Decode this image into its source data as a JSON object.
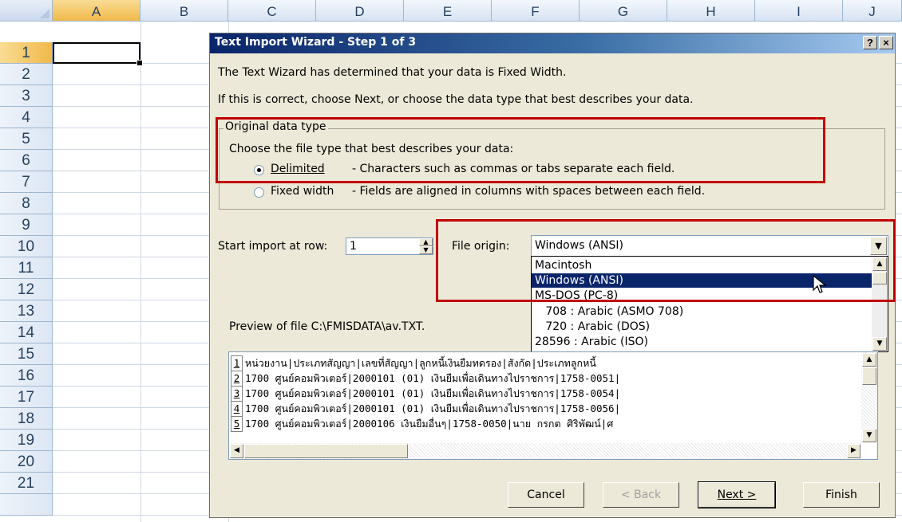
{
  "spreadsheet": {
    "columns": [
      "A",
      "B",
      "C",
      "D",
      "E",
      "F",
      "G",
      "H",
      "I",
      "J"
    ],
    "rows": [
      "1",
      "2",
      "3",
      "4",
      "5",
      "6",
      "7",
      "8",
      "9",
      "10",
      "11",
      "12",
      "13",
      "14",
      "15",
      "16",
      "17",
      "18",
      "19",
      "20",
      "21"
    ],
    "selected_column": "A",
    "selected_row": "1"
  },
  "dialog": {
    "title": "Text Import Wizard - Step 1 of 3",
    "help_button": "?",
    "close_button": "×",
    "intro_line1": "The Text Wizard has determined that your data is Fixed Width.",
    "intro_line2": "If this is correct, choose Next, or choose the data type that best describes your data.",
    "group_label": "Original data type",
    "choose_text": "Choose the file type that best describes your data:",
    "delimited_label": "Delimited",
    "delimited_desc": "- Characters such as commas or tabs separate each field.",
    "fixed_label": "Fixed width",
    "fixed_desc": "- Fields are aligned in columns with spaces between each field.",
    "start_row_label": "Start import at row:",
    "start_row_value": "1",
    "file_origin_label": "File origin:",
    "file_origin_value": "Windows (ANSI)",
    "file_origin_options": [
      "Macintosh",
      "Windows (ANSI)",
      "MS-DOS (PC-8)",
      "   708 : Arabic (ASMO 708)",
      "   720 : Arabic (DOS)",
      "28596 : Arabic (ISO)"
    ],
    "preview_label": "Preview of file C:\\FMISDATA\\av.TXT.",
    "preview_lines": [
      {
        "num": "1",
        "text": "หน่วยงาน|ประเภทสัญญา|เลขที่สัญญา|ลูกหนี้เงินยืมทดรอง|สังกัด|ประเภทลูกหนี้"
      },
      {
        "num": "2",
        "text": "1700 ศูนย์คอมพิวเตอร์|2000101  (01)  เงินยืมเพื่อเดินทางไปราชการ|1758-0051|"
      },
      {
        "num": "3",
        "text": "1700 ศูนย์คอมพิวเตอร์|2000101  (01)  เงินยืมเพื่อเดินทางไปราชการ|1758-0054|"
      },
      {
        "num": "4",
        "text": "1700 ศูนย์คอมพิวเตอร์|2000101  (01)  เงินยืมเพื่อเดินทางไปราชการ|1758-0056|"
      },
      {
        "num": "5",
        "text": "1700 ศูนย์คอมพิวเตอร์|2000106 เงินยืมอื่นๆ|1758-0050|นาย กรกต ศิริพัฒน์|ศ"
      }
    ],
    "buttons": {
      "cancel": "Cancel",
      "back": "< Back",
      "next": "Next >",
      "finish": "Finish"
    }
  },
  "colors": {
    "highlight": "#c00000",
    "title_start": "#0a246a",
    "dialog_bg": "#ece9d8"
  }
}
